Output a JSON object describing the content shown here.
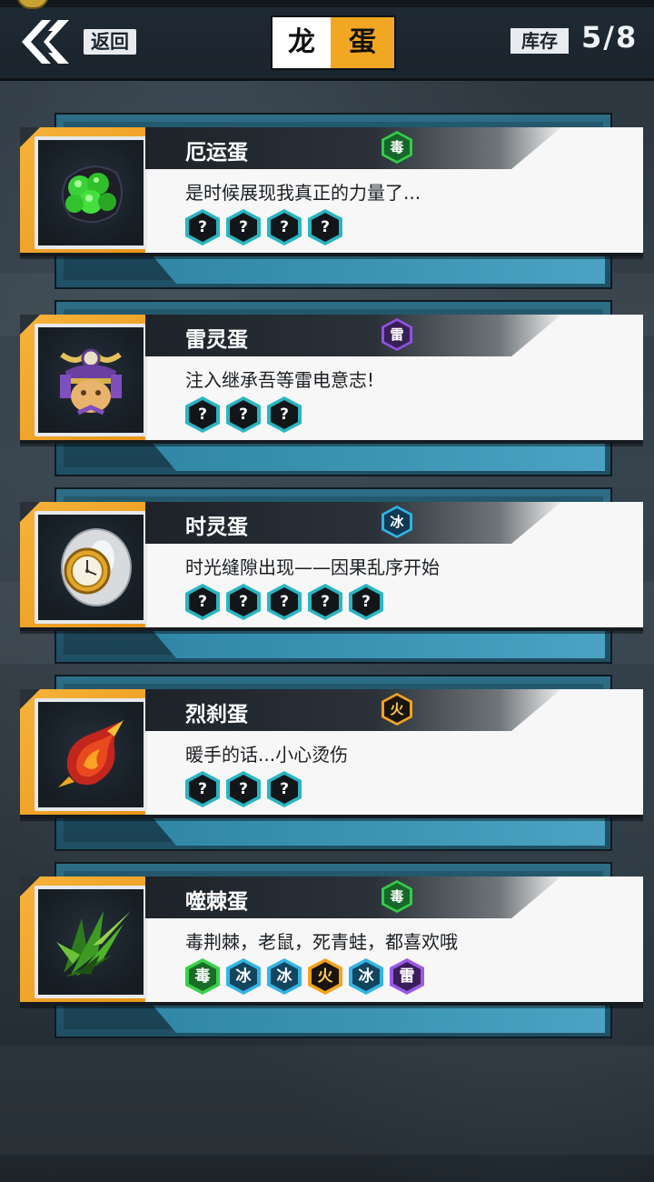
{
  "header": {
    "back_label": "返回",
    "title_left": "龙",
    "title_right": "蛋",
    "stock_label": "库存",
    "stock_value": "5/8"
  },
  "eggs": [
    {
      "name": "厄运蛋",
      "element": "毒",
      "element_color": "#35cc47",
      "description": "是时候展现我真正的力量了...",
      "slots": [
        "?",
        "?",
        "?",
        "?"
      ],
      "art": "green-poison-egg-icon"
    },
    {
      "name": "雷灵蛋",
      "element": "雷",
      "element_color": "#8f52e0",
      "description": "注入继承吾等雷电意志!",
      "slots": [
        "?",
        "?",
        "?"
      ],
      "art": "samurai-helmet-egg-icon"
    },
    {
      "name": "时灵蛋",
      "element": "冰",
      "element_color": "#2fb3e6",
      "description": "时光缝隙出现——因果乱序开始",
      "slots": [
        "?",
        "?",
        "?",
        "?",
        "?"
      ],
      "art": "clock-egg-icon"
    },
    {
      "name": "烈刹蛋",
      "element": "火",
      "element_color": "#f4a31e",
      "description": "暖手的话...小心烫伤",
      "slots": [
        "?",
        "?",
        "?"
      ],
      "art": "flame-egg-icon"
    },
    {
      "name": "噬棘蛋",
      "element": "毒",
      "element_color": "#35cc47",
      "description": "毒荆棘，老鼠，死青蛙，都喜欢哦",
      "slots": [
        "毒",
        "冰",
        "冰",
        "火",
        "冰",
        "雷"
      ],
      "art": "thorn-egg-icon"
    }
  ]
}
